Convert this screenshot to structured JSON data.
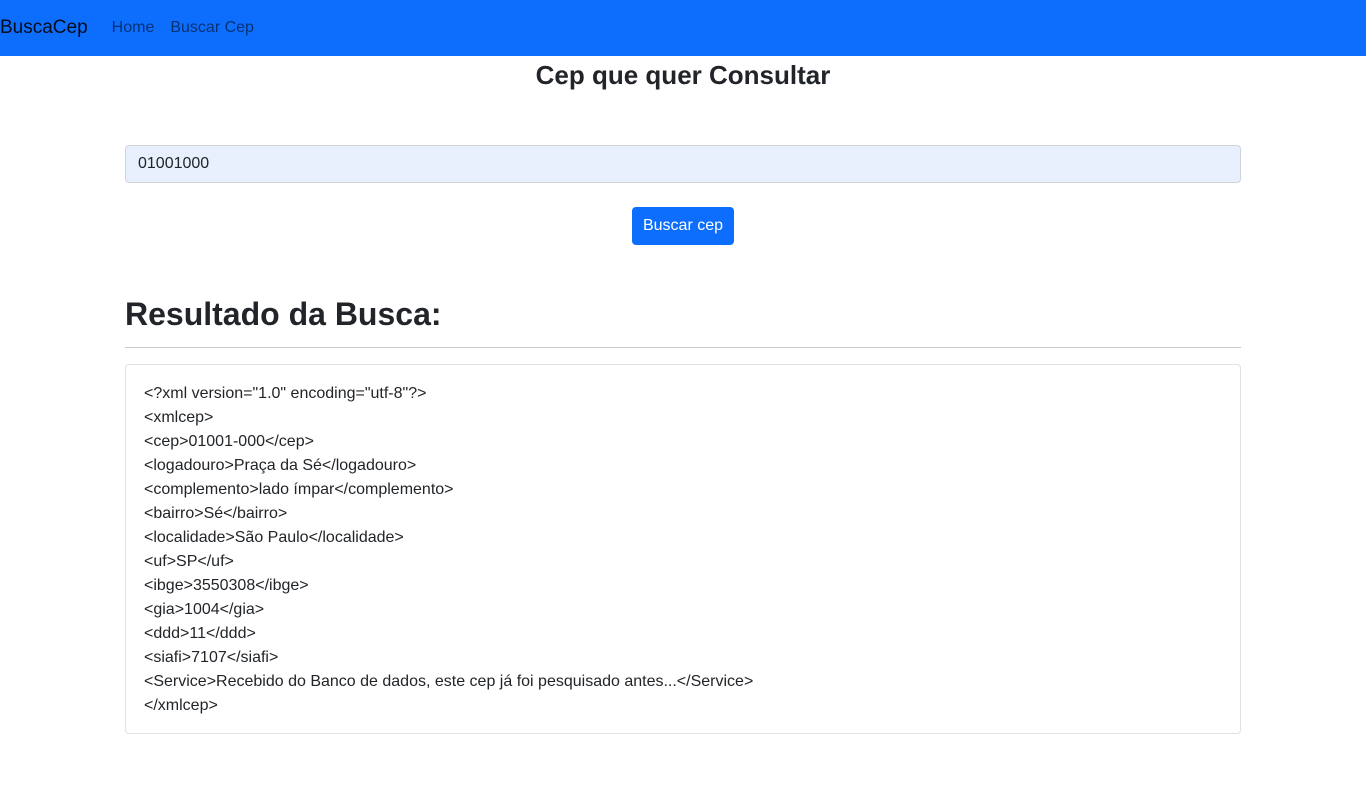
{
  "navbar": {
    "brand": "BuscaCep",
    "links": [
      "Home",
      "Buscar Cep"
    ],
    "background_color": "#0d6efd"
  },
  "form": {
    "title": "Cep que quer Consultar",
    "cep_value": "01001000",
    "button_label": "Buscar cep",
    "button_color": "#0d6efd"
  },
  "result": {
    "title": "Resultado da Busca:",
    "lines": [
      "<?xml version=\"1.0\" encoding=\"utf-8\"?>",
      "<xmlcep>",
      "<cep>01001-000</cep>",
      "<logadouro>Praça da Sé</logadouro>",
      "<complemento>lado ímpar</complemento>",
      "<bairro>Sé</bairro>",
      "<localidade>São Paulo</localidade>",
      "<uf>SP</uf>",
      "<ibge>3550308</ibge>",
      "<gia>1004</gia>",
      "<ddd>11</ddd>",
      "<siafi>7107</siafi>",
      "<Service>Recebido do Banco de dados, este cep já foi pesquisado antes...</Service>",
      "</xmlcep>"
    ]
  }
}
